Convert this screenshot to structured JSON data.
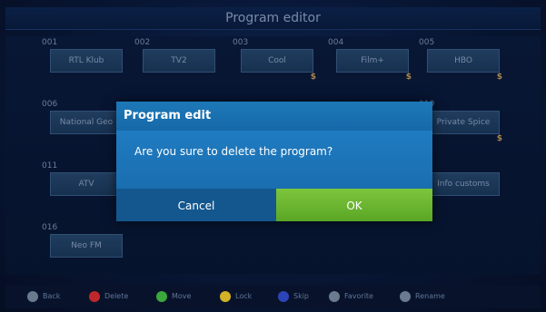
{
  "header": {
    "title": "Program editor"
  },
  "channels": [
    {
      "num": "001",
      "name": "RTL Klub"
    },
    {
      "num": "002",
      "name": "TV2"
    },
    {
      "num": "003",
      "name": "Cool",
      "mark": "$"
    },
    {
      "num": "004",
      "name": "Film+",
      "mark": "$"
    },
    {
      "num": "005",
      "name": "HBO",
      "mark": "$"
    },
    {
      "num": "006",
      "name": "National Geo"
    },
    {
      "num": "010",
      "name": "Private Spice",
      "mark": "$"
    },
    {
      "num": "011",
      "name": "ATV"
    },
    {
      "num": "",
      "name": "Info customs"
    },
    {
      "num": "016",
      "name": "Neo FM"
    }
  ],
  "dialog": {
    "title": "Program edit",
    "message": "Are you sure to delete the program?",
    "cancel_label": "Cancel",
    "ok_label": "OK"
  },
  "footer": {
    "keys": [
      {
        "label": "Back",
        "color": "#6a7a8f"
      },
      {
        "label": "Delete",
        "color": "#c0272d"
      },
      {
        "label": "Move",
        "color": "#3aa83a"
      },
      {
        "label": "Lock",
        "color": "#d2b227"
      },
      {
        "label": "Skip",
        "color": "#2c44b8"
      },
      {
        "label": "Favorite",
        "color": "#6a7a8f"
      },
      {
        "label": "Rename",
        "color": "#6a7a8f"
      }
    ]
  }
}
